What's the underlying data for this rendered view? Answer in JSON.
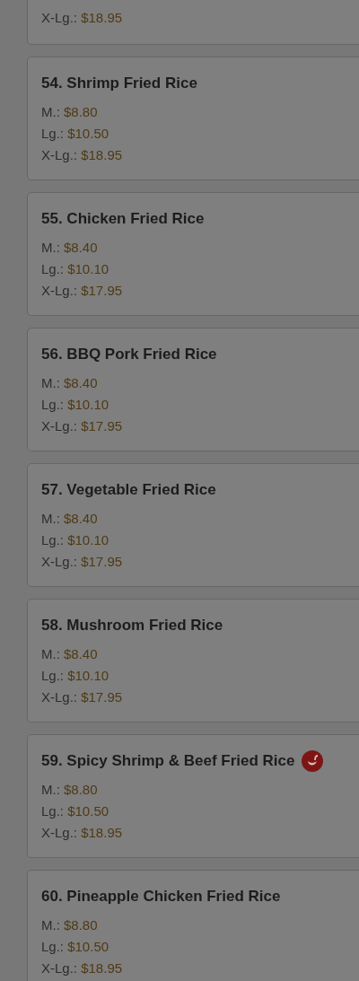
{
  "menu_items": [
    {
      "prices": [
        {
          "size": "X-Lg.:",
          "price": "$18.95"
        }
      ]
    },
    {
      "title": "54. Shrimp Fried Rice",
      "spicy": false,
      "prices": [
        {
          "size": "M.:",
          "price": "$8.80"
        },
        {
          "size": "Lg.:",
          "price": "$10.50"
        },
        {
          "size": "X-Lg.:",
          "price": "$18.95"
        }
      ]
    },
    {
      "title": "55. Chicken Fried Rice",
      "spicy": false,
      "prices": [
        {
          "size": "M.:",
          "price": "$8.40"
        },
        {
          "size": "Lg.:",
          "price": "$10.10"
        },
        {
          "size": "X-Lg.:",
          "price": "$17.95"
        }
      ]
    },
    {
      "title": "56. BBQ Pork Fried Rice",
      "spicy": false,
      "prices": [
        {
          "size": "M.:",
          "price": "$8.40"
        },
        {
          "size": "Lg.:",
          "price": "$10.10"
        },
        {
          "size": "X-Lg.:",
          "price": "$17.95"
        }
      ]
    },
    {
      "title": "57. Vegetable Fried Rice",
      "spicy": false,
      "prices": [
        {
          "size": "M.:",
          "price": "$8.40"
        },
        {
          "size": "Lg.:",
          "price": "$10.10"
        },
        {
          "size": "X-Lg.:",
          "price": "$17.95"
        }
      ]
    },
    {
      "title": "58. Mushroom Fried Rice",
      "spicy": false,
      "prices": [
        {
          "size": "M.:",
          "price": "$8.40"
        },
        {
          "size": "Lg.:",
          "price": "$10.10"
        },
        {
          "size": "X-Lg.:",
          "price": "$17.95"
        }
      ]
    },
    {
      "title": "59. Spicy Shrimp & Beef Fried Rice",
      "spicy": true,
      "prices": [
        {
          "size": "M.:",
          "price": "$8.80"
        },
        {
          "size": "Lg.:",
          "price": "$10.50"
        },
        {
          "size": "X-Lg.:",
          "price": "$18.95"
        }
      ]
    },
    {
      "title": "60. Pineapple Chicken Fried Rice",
      "spicy": false,
      "prices": [
        {
          "size": "M.:",
          "price": "$8.80"
        },
        {
          "size": "Lg.:",
          "price": "$10.50"
        },
        {
          "size": "X-Lg.:",
          "price": "$18.95"
        }
      ]
    }
  ]
}
